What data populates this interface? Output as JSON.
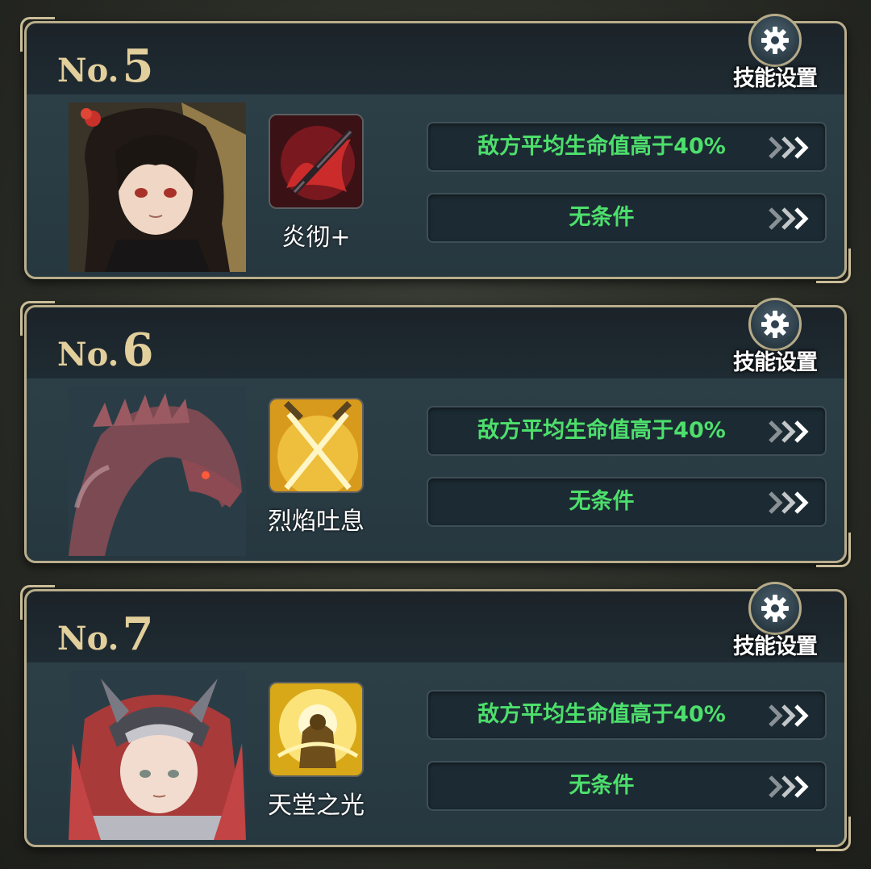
{
  "settings_label": "技能设置",
  "colors": {
    "condition_text": "#4ddf6c",
    "number_gold": "#e2cf9c",
    "frame_gold": "#b9ad8b"
  },
  "cards": [
    {
      "no_prefix": "No.",
      "number": "5",
      "portrait": "dark-haired-heroine-portrait",
      "skill_icon": "crimson-flame-sword-icon",
      "skill_name": "炎彻+",
      "conditions": [
        "敌方平均生命值高于40%",
        "无条件"
      ]
    },
    {
      "no_prefix": "No.",
      "number": "6",
      "portrait": "red-dragon-portrait",
      "skill_icon": "crossed-golden-swords-icon",
      "skill_name": "烈焰吐息",
      "conditions": [
        "敌方平均生命值高于40%",
        "无条件"
      ]
    },
    {
      "no_prefix": "No.",
      "number": "7",
      "portrait": "red-haired-knight-portrait",
      "skill_icon": "radiant-warrior-icon",
      "skill_name": "天堂之光",
      "conditions": [
        "敌方平均生命值高于40%",
        "无条件"
      ]
    }
  ]
}
